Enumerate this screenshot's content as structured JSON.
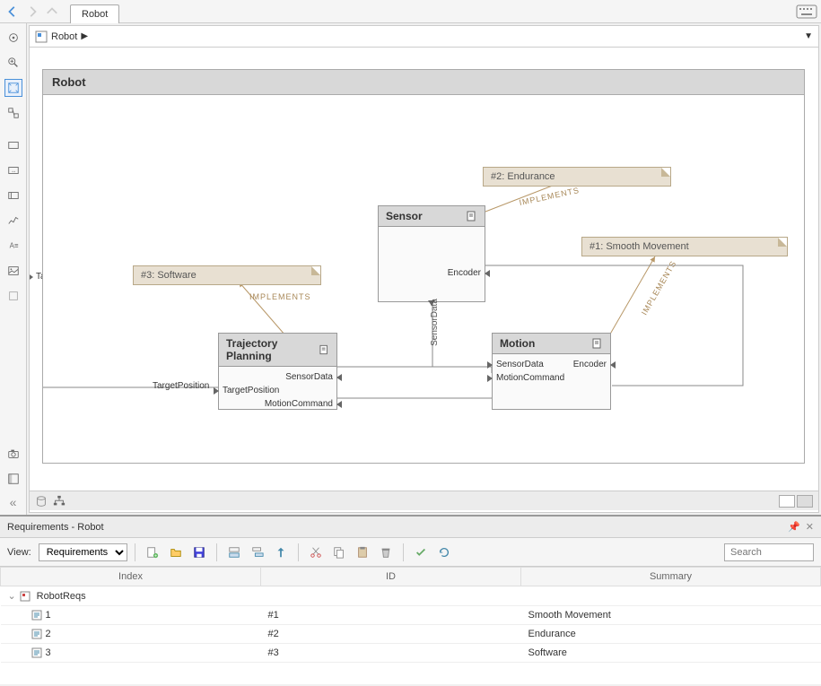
{
  "tab": {
    "title": "Robot"
  },
  "breadcrumb": {
    "root": "Robot"
  },
  "diagram": {
    "title": "Robot",
    "external_port": "TargetPosition",
    "external_port_label": "TargetPosition",
    "blocks": {
      "sensor": {
        "name": "Sensor",
        "ports": {
          "encoder": "Encoder"
        }
      },
      "trajectory": {
        "name": "Trajectory Planning",
        "ports": {
          "sensordata": "SensorData",
          "targetposition": "TargetPosition",
          "motioncommand": "MotionCommand"
        }
      },
      "motion": {
        "name": "Motion",
        "ports": {
          "sensordata": "SensorData",
          "motioncommand": "MotionCommand",
          "encoder": "Encoder"
        }
      }
    },
    "notes": {
      "n1": "#1: Smooth Movement",
      "n2": "#2: Endurance",
      "n3": "#3: Software"
    },
    "implements_label": "IMPLEMENTS",
    "sensor_data_label": "SensorData"
  },
  "requirements": {
    "title": "Requirements - Robot",
    "view_label": "View:",
    "view_value": "Requirements",
    "search_placeholder": "Search",
    "columns": {
      "index": "Index",
      "id": "ID",
      "summary": "Summary"
    },
    "root": "RobotReqs",
    "rows": [
      {
        "index": "1",
        "id": "#1",
        "summary": "Smooth Movement"
      },
      {
        "index": "2",
        "id": "#2",
        "summary": "Endurance"
      },
      {
        "index": "3",
        "id": "#3",
        "summary": "Software"
      }
    ]
  }
}
